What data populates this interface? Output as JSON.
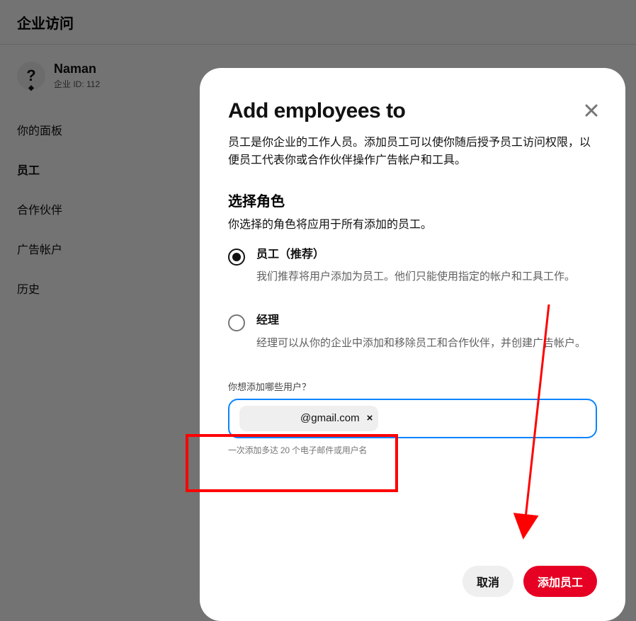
{
  "header": {
    "title": "企业访问"
  },
  "profile": {
    "avatar_text": "?",
    "name": "Naman",
    "id_label": "企业 ID: 112"
  },
  "sidebar": {
    "items": [
      {
        "label": "你的面板"
      },
      {
        "label": "员工"
      },
      {
        "label": "合作伙伴"
      },
      {
        "label": "广告帐户"
      },
      {
        "label": "历史"
      }
    ]
  },
  "modal": {
    "title": "Add employees to",
    "lead": "员工是你企业的工作人员。添加员工可以使你随后授予员工访问权限，以便员工代表你或合作伙伴操作广告帐户和工具。",
    "select_role_title": "选择角色",
    "select_role_sub": "你选择的角色将应用于所有添加的员工。",
    "roles": [
      {
        "title": "员工（推荐）",
        "desc": "我们推荐将用户添加为员工。他们只能使用指定的帐户和工具工作。",
        "checked": true
      },
      {
        "title": "经理",
        "desc": "经理可以从你的企业中添加和移除员工和合作伙伴，并创建广告帐户。",
        "checked": false
      }
    ],
    "field_label": "你想添加哪些用户？",
    "chip_value": "@gmail.com",
    "chip_remove": "×",
    "helper": "一次添加多达 20 个电子邮件或用户名",
    "cancel": "取消",
    "submit": "添加员工"
  }
}
